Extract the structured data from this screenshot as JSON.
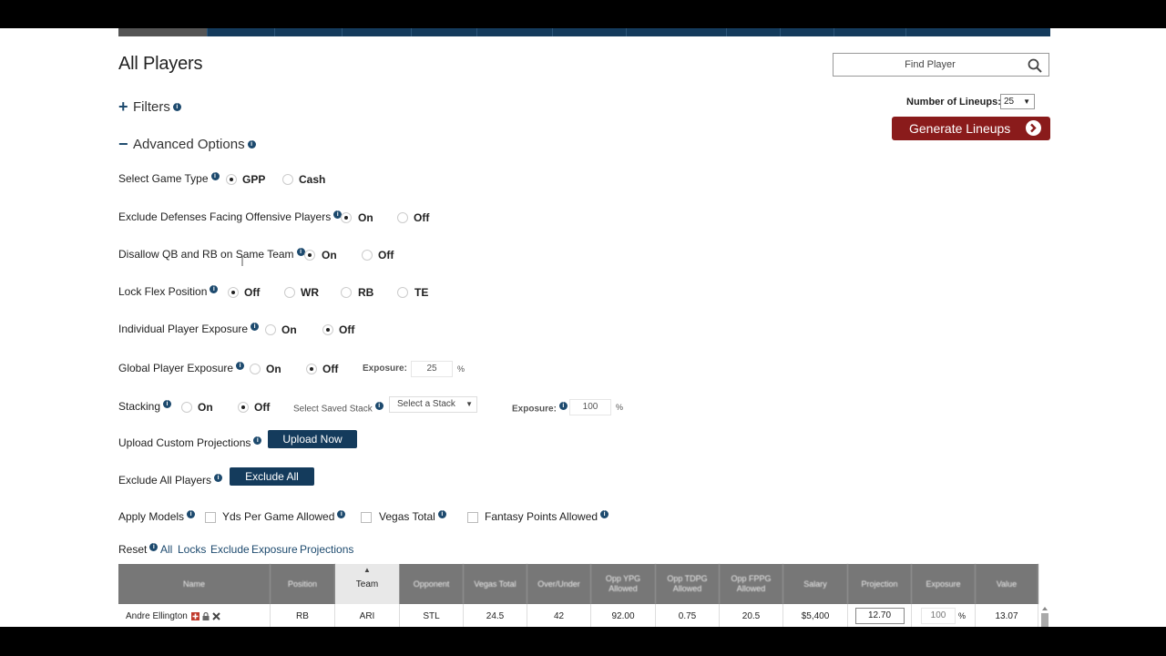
{
  "page": {
    "title": "All Players",
    "filters_label": "Filters",
    "advanced_label": "Advanced Options",
    "find_player_placeholder": "Find Player",
    "lineups_label": "Number of Lineups:",
    "lineups_value": "25",
    "generate_label": "Generate Lineups"
  },
  "options": {
    "game_type": {
      "label": "Select Game Type",
      "opt1": "GPP",
      "opt2": "Cash",
      "selected": "GPP"
    },
    "exclude_def": {
      "label": "Exclude Defenses Facing Offensive Players",
      "opt1": "On",
      "opt2": "Off",
      "selected": "On"
    },
    "disallow_qb": {
      "label": "Disallow QB and RB on Same Team",
      "opt1": "On",
      "opt2": "Off",
      "selected": "On"
    },
    "lock_flex": {
      "label": "Lock Flex Position",
      "opt1": "Off",
      "opt2": "WR",
      "opt3": "RB",
      "opt4": "TE",
      "selected": "Off"
    },
    "individual_exposure": {
      "label": "Individual Player Exposure",
      "opt1": "On",
      "opt2": "Off",
      "selected": "Off"
    },
    "global_exposure": {
      "label": "Global Player Exposure",
      "opt1": "On",
      "opt2": "Off",
      "selected": "Off",
      "exposure_label": "Exposure:",
      "exposure_value": "25",
      "pct": "%"
    },
    "stacking": {
      "label": "Stacking",
      "opt1": "On",
      "opt2": "Off",
      "selected": "Off",
      "saved_stack_label": "Select Saved Stack",
      "stack_placeholder": "Select a Stack",
      "exposure_label": "Exposure:",
      "exposure_value": "100",
      "pct": "%"
    },
    "upload": {
      "label": "Upload Custom Projections",
      "button": "Upload Now"
    },
    "exclude_all": {
      "label": "Exclude All Players",
      "button": "Exclude All"
    },
    "models": {
      "label": "Apply Models",
      "m1": "Yds Per Game Allowed",
      "m2": "Vegas Total",
      "m3": "Fantasy Points Allowed"
    },
    "reset": {
      "label": "Reset",
      "links": [
        "All",
        "Locks",
        "Exclude",
        "Exposure",
        "Projections"
      ]
    }
  },
  "table": {
    "headers": [
      "Name",
      "Position",
      "Team",
      "Opponent",
      "Vegas Total",
      "Over/Under",
      "Opp YPG Allowed",
      "Opp TDPG Allowed",
      "Opp FPPG Allowed",
      "Salary",
      "Projection",
      "Exposure",
      "Value"
    ],
    "active_header": "Team",
    "rows": [
      {
        "name": "Andre Ellington",
        "position": "RB",
        "team": "ARI",
        "opponent": "STL",
        "vegas": "24.5",
        "ou": "42",
        "ypg": "92.00",
        "tdpg": "0.75",
        "fppg": "20.5",
        "salary": "$5,400",
        "projection": "12.70",
        "exposure": "100",
        "pct": "%",
        "value": "13.07"
      }
    ]
  },
  "colors": {
    "navy": "#143b5c",
    "red": "#8a1b1b",
    "header_gray": "#777777"
  }
}
